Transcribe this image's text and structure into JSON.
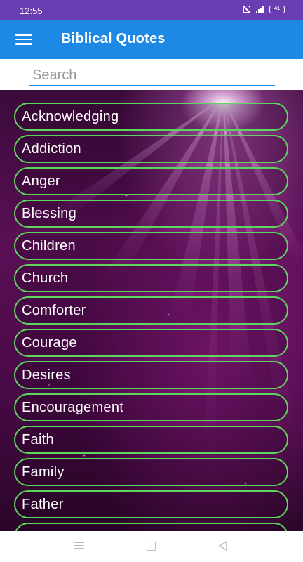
{
  "status_bar": {
    "time": "12:55",
    "battery": "41",
    "icons": [
      "do-not-disturb-icon",
      "signal-icon",
      "battery-icon"
    ]
  },
  "app_bar": {
    "title": "Biblical Quotes",
    "menu_icon": "hamburger-menu-icon",
    "background_color": "#1e88e5"
  },
  "search": {
    "value": "",
    "placeholder": "Search"
  },
  "topics": [
    "Acknowledging",
    "Addiction",
    "Anger",
    "Blessing",
    "Children",
    "Church",
    "Comforter",
    "Courage",
    "Desires",
    "Encouragement",
    "Faith",
    "Family",
    "Father",
    ""
  ],
  "colors": {
    "status_bar": "#6a3db3",
    "item_border": "#5cd65c",
    "item_text": "#ffffff"
  },
  "nav_bar": {
    "icons": [
      "recents-icon",
      "home-icon",
      "back-icon"
    ]
  }
}
